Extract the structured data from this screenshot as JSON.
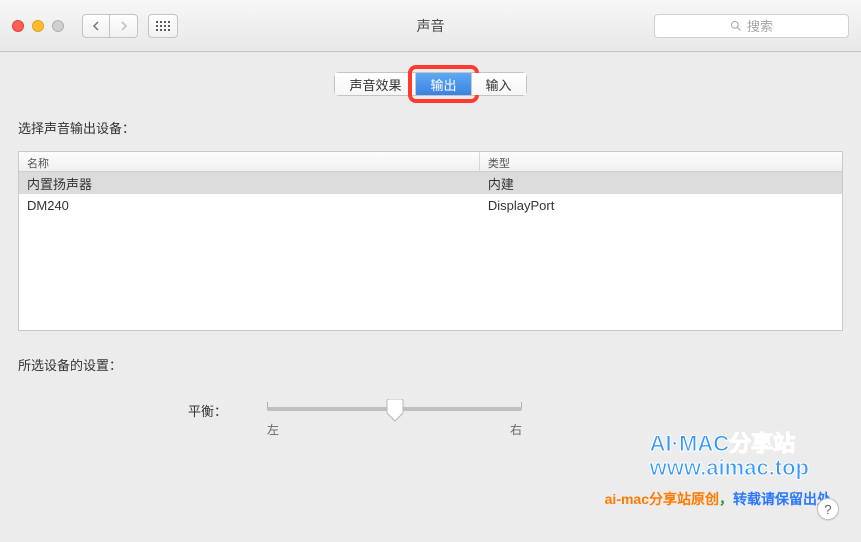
{
  "window": {
    "title": "声音"
  },
  "search": {
    "placeholder": "搜索"
  },
  "tabs": [
    {
      "label": "声音效果",
      "active": false
    },
    {
      "label": "输出",
      "active": true,
      "highlighted": true
    },
    {
      "label": "输入",
      "active": false
    }
  ],
  "section_label": "选择声音输出设备：",
  "columns": {
    "name": "名称",
    "type": "类型"
  },
  "devices": [
    {
      "name": "内置扬声器",
      "type": "内建",
      "selected": true
    },
    {
      "name": "DM240",
      "type": "DisplayPort",
      "selected": false
    }
  ],
  "settings_label": "所选设备的设置：",
  "balance": {
    "label": "平衡：",
    "left": "左",
    "right": "右"
  },
  "watermark": {
    "line1": "AI·MAC分享站",
    "line2": "www.aimac.top",
    "footer_a": "ai-mac分享站原创",
    "footer_b": "，",
    "footer_c": "转载请保留出处"
  },
  "help": "?"
}
